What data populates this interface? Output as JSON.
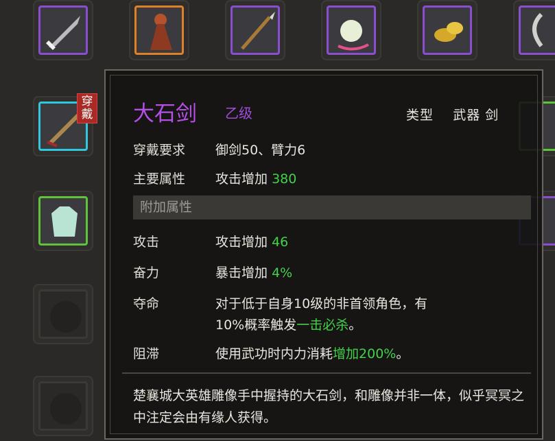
{
  "inventory": {
    "equipped_tag": "穿戴",
    "slots": [
      {
        "name": "sword-item",
        "rarity": "purple"
      },
      {
        "name": "cloak-item",
        "rarity": "orange"
      },
      {
        "name": "spear-item",
        "rarity": "purple"
      },
      {
        "name": "flower-item",
        "rarity": "purple"
      },
      {
        "name": "gold-item",
        "rarity": "purple"
      },
      {
        "name": "blade-item",
        "rarity": "purple"
      }
    ]
  },
  "tooltip": {
    "title": "大石剑",
    "grade": "乙级",
    "type_label": "类型",
    "type_value": "武器 剑",
    "requirement_label": "穿戴要求",
    "requirement_value": "御剑50、臂力6",
    "main_attr_label": "主要属性",
    "main_attr_text": "攻击增加",
    "main_attr_value": "380",
    "extra_header": "附加属性",
    "attrs": [
      {
        "label": "攻击",
        "text": "攻击增加",
        "value": "46"
      },
      {
        "label": "奋力",
        "text": "暴击增加",
        "value": "4%"
      }
    ],
    "duoming_label": "夺命",
    "duoming_line1": "对于低于自身10级的非首领角色，有",
    "duoming_line2_prefix": "10%概率触发",
    "duoming_line2_highlight": "一击必杀",
    "duoming_line2_suffix": "。",
    "zhizhi_label": "阻滞",
    "zhizhi_prefix": "使用武功时内力消耗",
    "zhizhi_highlight": "增加200%",
    "zhizhi_suffix": "。",
    "description": "楚襄城大英雄雕像手中握持的大石剑，和雕像并非一体，似乎冥冥之中注定会由有缘人获得。"
  },
  "colors": {
    "purple": "#8a4fd0",
    "orange": "#e0812a",
    "cyan": "#33c7df",
    "green": "#5fc43b",
    "highlight": "#42d24a"
  }
}
